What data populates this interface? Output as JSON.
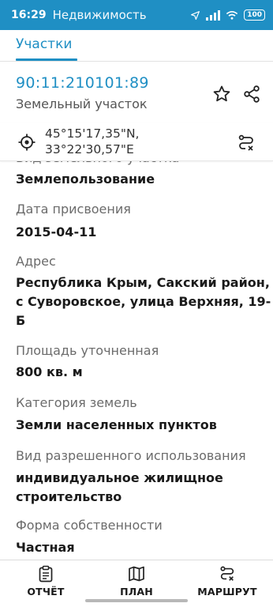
{
  "status_bar": {
    "time": "16:29",
    "title": "Недвижимость",
    "battery": "100"
  },
  "tabs": {
    "active": "Участки"
  },
  "parcel": {
    "cadastral_number": "90:11:210101:89",
    "type": "Земельный участок"
  },
  "coordinates": {
    "lat": "45°15'17,35\"N,",
    "lon": "33°22'30,57\"E"
  },
  "details": {
    "partial_label": "Вид земельного участка",
    "partial_value": "Землепользование",
    "fields": [
      {
        "label": "Дата присвоения",
        "value": "2015-04-11"
      },
      {
        "label": "Адрес",
        "value": "Республика Крым, Сакский район, с Суворовское, улица Верхняя, 19-Б"
      },
      {
        "label": "Площадь уточненная",
        "value": "800 кв. м"
      },
      {
        "label": "Категория земель",
        "value": "Земли населенных пунктов"
      },
      {
        "label": "Вид разрешенного использования",
        "value": "индивидуальное жилищное строительство"
      },
      {
        "label": "Форма собственности",
        "value": "Частная"
      }
    ]
  },
  "bottom_nav": {
    "report": "ОТЧЁТ",
    "plan": "ПЛАН",
    "route": "МАРШРУТ"
  },
  "colors": {
    "accent": "#1f8fc4",
    "text": "#1a1a1a",
    "muted": "#6b6b6b"
  }
}
